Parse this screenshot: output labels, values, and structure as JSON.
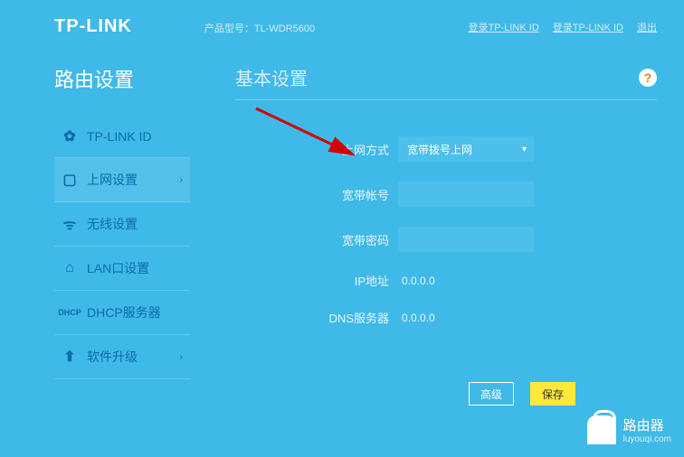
{
  "header": {
    "logo": "TP-LINK",
    "product_label": "产品型号：TL-WDR5600",
    "links": {
      "link_id5": "登录TP-LINK ID",
      "link_id6": "登录TP-LINK ID",
      "logout": "退出"
    }
  },
  "sidebar": {
    "title": "路由设置",
    "items": [
      {
        "label": "TP-LINK ID"
      },
      {
        "label": "上网设置"
      },
      {
        "label": "无线设置"
      },
      {
        "label": "LAN口设置"
      },
      {
        "label": "DHCP服务器"
      },
      {
        "label": "软件升级"
      }
    ]
  },
  "content": {
    "section_title": "基本设置",
    "help": "?",
    "fields": {
      "wan_type_label": "上网方式",
      "wan_type_value": "宽带拨号上网",
      "account_label": "宽带帐号",
      "account_value": "",
      "password_label": "宽带密码",
      "password_value": "",
      "ip_label": "IP地址",
      "ip_value": "0.0.0.0",
      "dns_label": "DNS服务器",
      "dns_value": "0.0.0.0"
    },
    "buttons": {
      "advanced": "高级",
      "save": "保存"
    }
  },
  "watermark": {
    "title": "路由器",
    "sub": "luyouqi.com"
  }
}
